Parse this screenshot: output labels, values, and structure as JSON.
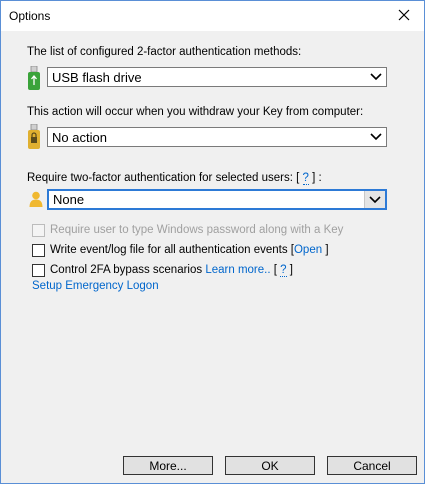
{
  "window": {
    "title": "Options"
  },
  "methods": {
    "label": "The list of configured 2-factor authentication methods:",
    "selected": "USB flash drive"
  },
  "withdraw": {
    "label": "This action will occur when you withdraw your Key from computer:",
    "selected": "No action"
  },
  "users": {
    "label": "Require two-factor authentication for selected users:",
    "help_open": "[",
    "help_q": "?",
    "help_close": "]",
    "colon": ":",
    "selected": "None"
  },
  "options": {
    "require_password": "Require user to type Windows password along with a Key",
    "write_log": "Write event/log file for all authentication events [",
    "open_link": "Open",
    "write_log_close": "]",
    "bypass": "Control 2FA bypass scenarios",
    "learn_more": "Learn more..",
    "bypass_help_open": "[",
    "bypass_help_q": "?",
    "bypass_help_close": "]",
    "emergency": "Setup Emergency Logon"
  },
  "buttons": {
    "more": "More...",
    "ok": "OK",
    "cancel": "Cancel"
  },
  "colors": {
    "accent": "#2d7ad6",
    "link": "#0066cc",
    "usb_green": "#3aa33a",
    "key_gold": "#e0b030",
    "user_gold": "#f0b830"
  }
}
